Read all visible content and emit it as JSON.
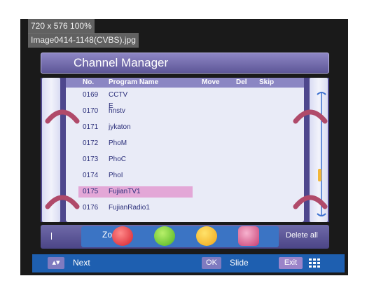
{
  "overlay": {
    "resolution": "720 x 576 100%",
    "filename": "Image0414-1148(CVBS).jpg"
  },
  "title": "Channel Manager",
  "columns": {
    "no": "No.",
    "program": "Program Name",
    "move": "Move",
    "del": "Del",
    "skip": "Skip"
  },
  "channels": [
    {
      "no": "0169",
      "name": "CCTV E"
    },
    {
      "no": "0170",
      "name": "hnstv"
    },
    {
      "no": "0171",
      "name": "jykaton"
    },
    {
      "no": "0172",
      "name": "PhoM"
    },
    {
      "no": "0173",
      "name": "PhoC"
    },
    {
      "no": "0174",
      "name": "PhoI"
    },
    {
      "no": "0175",
      "name": "FujianTV1"
    },
    {
      "no": "0176",
      "name": "FujianRadio1"
    }
  ],
  "selected_index": 6,
  "bottom": {
    "zoom_label": "Zoom",
    "delete_all": "Delete all"
  },
  "footer": {
    "next": "Next",
    "ok": "OK",
    "slide": "Slide",
    "exit": "Exit"
  },
  "icons": {
    "red": "mute-icon",
    "green": "music-icon",
    "yellow": "lock-icon",
    "pink": "delete-icon"
  },
  "colors": {
    "accent": "#5e5798",
    "selection": "#e3a7d7",
    "footer": "#1e5fb0"
  }
}
